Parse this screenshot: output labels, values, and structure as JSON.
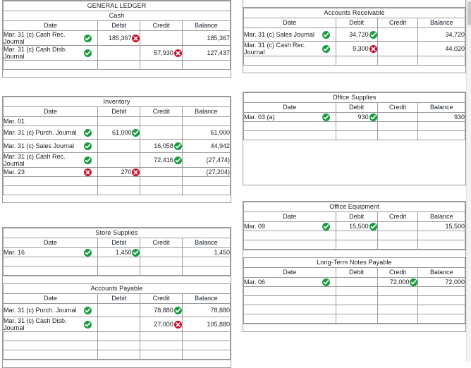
{
  "page": {
    "heading": "GENERAL LEDGER",
    "columns": [
      "Date",
      "Debit",
      "Credit",
      "Balance"
    ],
    "colors": {
      "header_blue": "#6cabe5",
      "correct_green": "#199c3f",
      "incorrect_red": "#c8102e",
      "row_ok_bg": "#eff7ee",
      "row_bad_bg": "#fdefef",
      "grid_line": "#9a9a9a"
    },
    "icons": {
      "ok": "check-circle-icon",
      "bad": "x-circle-icon"
    }
  },
  "accounts": {
    "cash": {
      "title": "Cash",
      "rows": [
        {
          "date": "Mar. 31 (c) Cash Rec. Journal",
          "date_status": "ok",
          "debit": "185,367",
          "debit_status": "bad",
          "credit": "",
          "credit_status": "",
          "balance": "185,367"
        },
        {
          "date": "Mar. 31 (c) Cash Disb. Journal",
          "date_status": "ok",
          "debit": "",
          "debit_status": "",
          "credit": "57,930",
          "credit_status": "bad",
          "balance": "127,437"
        },
        {
          "date": "",
          "date_status": "",
          "debit": "",
          "debit_status": "",
          "credit": "",
          "credit_status": "",
          "balance": ""
        }
      ]
    },
    "accounts_receivable": {
      "title": "Accounts Receivable",
      "rows": [
        {
          "date": "Mar. 31 (c) Sales Journal",
          "date_status": "ok",
          "debit": "34,720",
          "debit_status": "ok",
          "credit": "",
          "credit_status": "",
          "balance": "34,720"
        },
        {
          "date": "Mar. 31 (c) Cash Rec. Journal",
          "date_status": "ok",
          "debit": "9,300",
          "debit_status": "bad",
          "credit": "",
          "credit_status": "",
          "balance": "44,020"
        },
        {
          "date": "",
          "date_status": "",
          "debit": "",
          "debit_status": "",
          "credit": "",
          "credit_status": "",
          "balance": ""
        }
      ]
    },
    "inventory": {
      "title": "Inventory",
      "rows": [
        {
          "date": "Mar. 01",
          "date_status": "",
          "debit": "",
          "debit_status": "",
          "credit": "",
          "credit_status": "",
          "balance": ""
        },
        {
          "date": "Mar. 31 (c) Purch. Journal",
          "date_status": "ok",
          "debit": "61,000",
          "debit_status": "ok",
          "credit": "",
          "credit_status": "",
          "balance": "61,000"
        },
        {
          "date": "Mar. 31 (c) Sales Journal",
          "date_status": "ok",
          "debit": "",
          "debit_status": "",
          "credit": "16,058",
          "credit_status": "ok",
          "balance": "44,942"
        },
        {
          "date": "Mar. 31 (c) Cash Rec. Journal",
          "date_status": "ok",
          "debit": "",
          "debit_status": "",
          "credit": "72,416",
          "credit_status": "ok",
          "balance": "(27,474)"
        },
        {
          "date": "Mar. 23",
          "date_status": "bad",
          "debit": "270",
          "debit_status": "bad",
          "credit": "",
          "credit_status": "",
          "balance": "(27,204)"
        },
        {
          "date": "",
          "date_status": "",
          "debit": "",
          "debit_status": "",
          "credit": "",
          "credit_status": "",
          "balance": ""
        },
        {
          "date": "",
          "date_status": "",
          "debit": "",
          "debit_status": "",
          "credit": "",
          "credit_status": "",
          "balance": ""
        }
      ]
    },
    "office_supplies": {
      "title": "Office Supplies",
      "rows": [
        {
          "date": "Mar. 03 (a)",
          "date_status": "ok",
          "debit": "930",
          "debit_status": "ok",
          "credit": "",
          "credit_status": "",
          "balance": "930"
        },
        {
          "date": "",
          "date_status": "",
          "debit": "",
          "debit_status": "",
          "credit": "",
          "credit_status": "",
          "balance": ""
        },
        {
          "date": "",
          "date_status": "",
          "debit": "",
          "debit_status": "",
          "credit": "",
          "credit_status": "",
          "balance": ""
        }
      ]
    },
    "store_supplies": {
      "title": "Store Supplies",
      "rows": [
        {
          "date": "Mar. 16",
          "date_status": "ok",
          "debit": "1,450",
          "debit_status": "ok",
          "credit": "",
          "credit_status": "",
          "balance": "1,450"
        },
        {
          "date": "",
          "date_status": "",
          "debit": "",
          "debit_status": "",
          "credit": "",
          "credit_status": "",
          "balance": ""
        },
        {
          "date": "",
          "date_status": "",
          "debit": "",
          "debit_status": "",
          "credit": "",
          "credit_status": "",
          "balance": ""
        }
      ]
    },
    "office_equipment": {
      "title": "Office Equipment",
      "rows": [
        {
          "date": "Mar. 09",
          "date_status": "ok",
          "debit": "15,500",
          "debit_status": "ok",
          "credit": "",
          "credit_status": "",
          "balance": "15,500"
        },
        {
          "date": "",
          "date_status": "",
          "debit": "",
          "debit_status": "",
          "credit": "",
          "credit_status": "",
          "balance": ""
        },
        {
          "date": "",
          "date_status": "",
          "debit": "",
          "debit_status": "",
          "credit": "",
          "credit_status": "",
          "balance": ""
        }
      ]
    },
    "accounts_payable": {
      "title": "Accounts Payable",
      "rows": [
        {
          "date": "Mar. 31 (c) Purch. Journal",
          "date_status": "ok",
          "debit": "",
          "debit_status": "",
          "credit": "78,880",
          "credit_status": "ok",
          "balance": "78,880"
        },
        {
          "date": "Mar. 31 (c) Cash Disb. Journal",
          "date_status": "ok",
          "debit": "",
          "debit_status": "",
          "credit": "27,000",
          "credit_status": "bad",
          "balance": "105,880"
        },
        {
          "date": "",
          "date_status": "",
          "debit": "",
          "debit_status": "",
          "credit": "",
          "credit_status": "",
          "balance": ""
        },
        {
          "date": "",
          "date_status": "",
          "debit": "",
          "debit_status": "",
          "credit": "",
          "credit_status": "",
          "balance": ""
        },
        {
          "date": "",
          "date_status": "",
          "debit": "",
          "debit_status": "",
          "credit": "",
          "credit_status": "",
          "balance": ""
        }
      ]
    },
    "long_term_notes_payable": {
      "title": "Long-Term Notes Payable",
      "rows": [
        {
          "date": "Mar. 06",
          "date_status": "ok",
          "debit": "",
          "debit_status": "",
          "credit": "72,000",
          "credit_status": "ok",
          "balance": "72,000"
        },
        {
          "date": "",
          "date_status": "",
          "debit": "",
          "debit_status": "",
          "credit": "",
          "credit_status": "",
          "balance": ""
        },
        {
          "date": "",
          "date_status": "",
          "debit": "",
          "debit_status": "",
          "credit": "",
          "credit_status": "",
          "balance": ""
        },
        {
          "date": "",
          "date_status": "",
          "debit": "",
          "debit_status": "",
          "credit": "",
          "credit_status": "",
          "balance": ""
        },
        {
          "date": "",
          "date_status": "",
          "debit": "",
          "debit_status": "",
          "credit": "",
          "credit_status": "",
          "balance": ""
        }
      ]
    }
  }
}
